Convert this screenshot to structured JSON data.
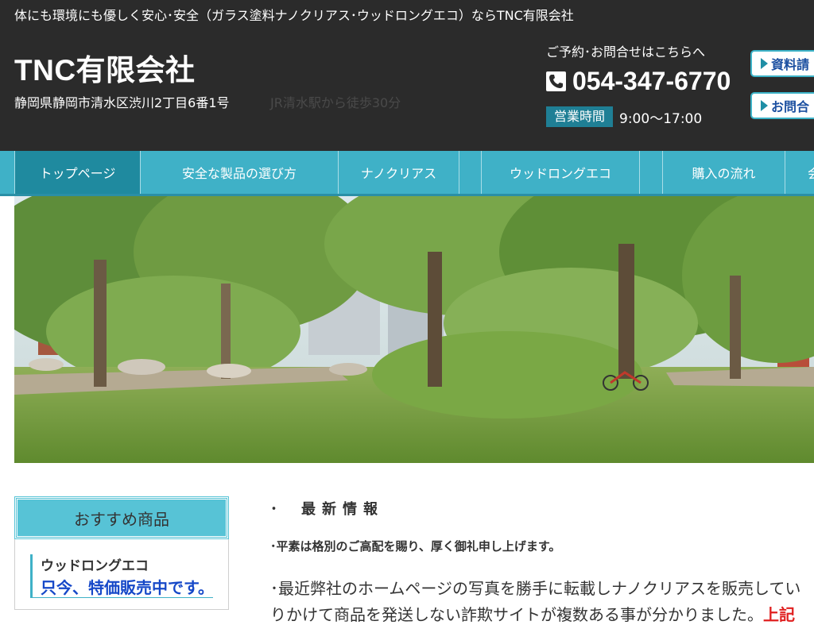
{
  "header": {
    "tagline": "体にも環境にも優しく安心･安全（ガラス塗料ナノクリアス･ウッドロングエコ）ならTNC有限会社",
    "site_title": "TNC有限会社",
    "address": "静岡県静岡市清水区渋川2丁目6番1号",
    "access": "JR清水駅から徒歩30分",
    "contact_lead": "ご予約･お問合せはこちらへ",
    "phone": "054-347-6770",
    "hours_label": "営業時間",
    "hours_value": "9:00〜17:00",
    "buttons": {
      "documents": "資料請",
      "inquiry": "お問合"
    }
  },
  "nav": {
    "items": [
      {
        "label": "トップページ",
        "active": true
      },
      {
        "label": "安全な製品の選び方"
      },
      {
        "label": "ナノクリアス"
      },
      {
        "label": "ウッドロングエコ"
      },
      {
        "label": "購入の流れ"
      },
      {
        "label": "会"
      }
    ]
  },
  "sidebar": {
    "heading": "おすすめ商品",
    "card_title": "ウッドロングエコ",
    "card_subtitle": "只今、特価販売中です。"
  },
  "news": {
    "bullet": "･",
    "heading": "最新情報",
    "line1": "･平素は格別のご高配を賜り、厚く御礼申し上げます。",
    "line2": "･最近弊社のホームページの写真を勝手に転載しナノクリアスを販売してい",
    "line3_prefix": "りかけて商品を発送しない詐欺サイトが複数ある事が分かりました。",
    "line3_red": "上記"
  },
  "colors": {
    "header_bg": "#2b2b2b",
    "nav_bg": "#3fb1c7",
    "nav_active": "#1f8a9f",
    "accent_blue": "#1648c8"
  },
  "icons": {
    "phone": "phone-icon",
    "button_arrow": "triangle-right-icon"
  },
  "hero": {
    "description_icon": "park-photo"
  }
}
